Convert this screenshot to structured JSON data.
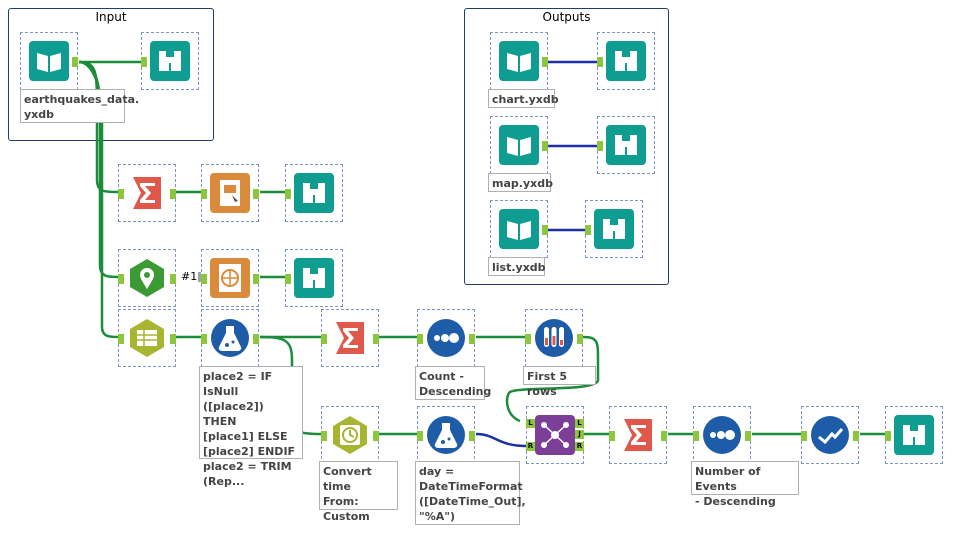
{
  "containers": {
    "input": "Input",
    "outputs": "Outputs"
  },
  "annotations": {
    "input_file": "earthquakes_data.\nyxdb",
    "chart_file": "chart.yxdb",
    "map_file": "map.yxdb",
    "list_file": "list.yxdb",
    "formula1": "place2 = IF IsNull\n([place2]) THEN\n[place1] ELSE\n[place2] ENDIF\nplace2 = TRIM\n(Rep...",
    "sort1": "Count -\nDescending",
    "sample": "First 5 rows",
    "datetime": "Convert time\nFrom:\nCustom",
    "formula2": "day =\nDateTimeFormat\n([DateTime_Out],\n\"%A\")",
    "sort2": "Number of Events\n- Descending"
  },
  "connection_label": "#1",
  "join_anchors": {
    "left": "L",
    "right": "R",
    "out_j": "J",
    "out_l": "L",
    "out_r": "R"
  },
  "colors": {
    "teal": "#0f9d91",
    "summarize": "#e0584a",
    "report": "#d98a3a",
    "spatial": "#3c9a35",
    "parse": "#a8b530",
    "formula": "#1f5ca8",
    "datetime": "#a8b530",
    "join": "#7b3f98",
    "wire_green": "#1a8c3a",
    "wire_blue": "#1b2fa8"
  },
  "icons": {
    "input": "book-icon",
    "browse": "binoculars-icon",
    "summarize": "sigma-icon",
    "report": "render-icon",
    "map": "map-pin-icon",
    "globe": "globe-icon",
    "parse": "text-to-columns-icon",
    "formula": "flask-icon",
    "sort": "dots-icon",
    "sample": "test-tubes-icon",
    "datetime": "clock-icon",
    "join": "join-icon",
    "select": "check-icon"
  }
}
